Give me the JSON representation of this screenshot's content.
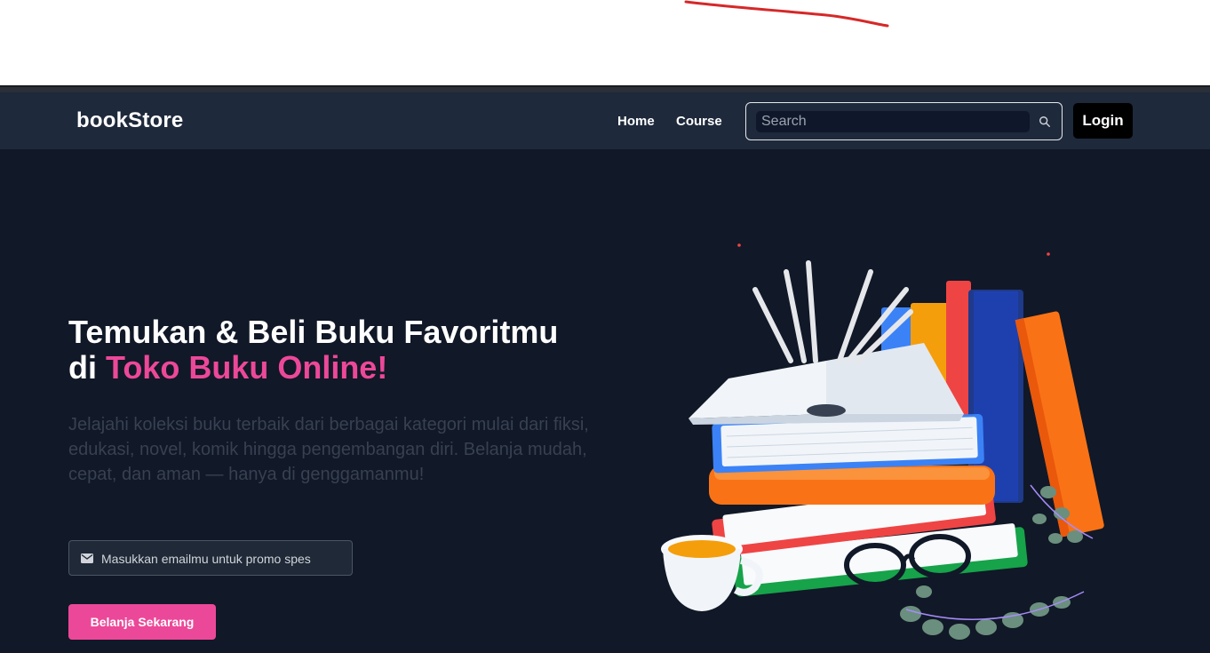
{
  "navbar": {
    "brand": "bookStore",
    "links": [
      {
        "label": "Home"
      },
      {
        "label": "Course"
      }
    ],
    "search": {
      "placeholder": "Search",
      "value": ""
    },
    "login_label": "Login"
  },
  "hero": {
    "title_line1": "Temukan & Beli Buku Favoritmu",
    "title_prefix": "di ",
    "title_accent": "Toko Buku Online!",
    "description": "Jelajahi koleksi buku terbaik dari berbagai kategori mulai dari fiksi, edukasi, novel, komik hingga pengembangan diri. Belanja mudah, cepat, dan aman — hanya di genggamanmu!",
    "email_placeholder": "Masukkan emailmu untuk promo spes",
    "cta_label": "Belanja Sekarang"
  },
  "colors": {
    "navbar_bg": "#1e293b",
    "hero_bg": "#111827",
    "accent": "#ec4899",
    "login_bg": "#000000"
  },
  "icons": {
    "search": "search-icon",
    "email": "envelope-icon"
  }
}
